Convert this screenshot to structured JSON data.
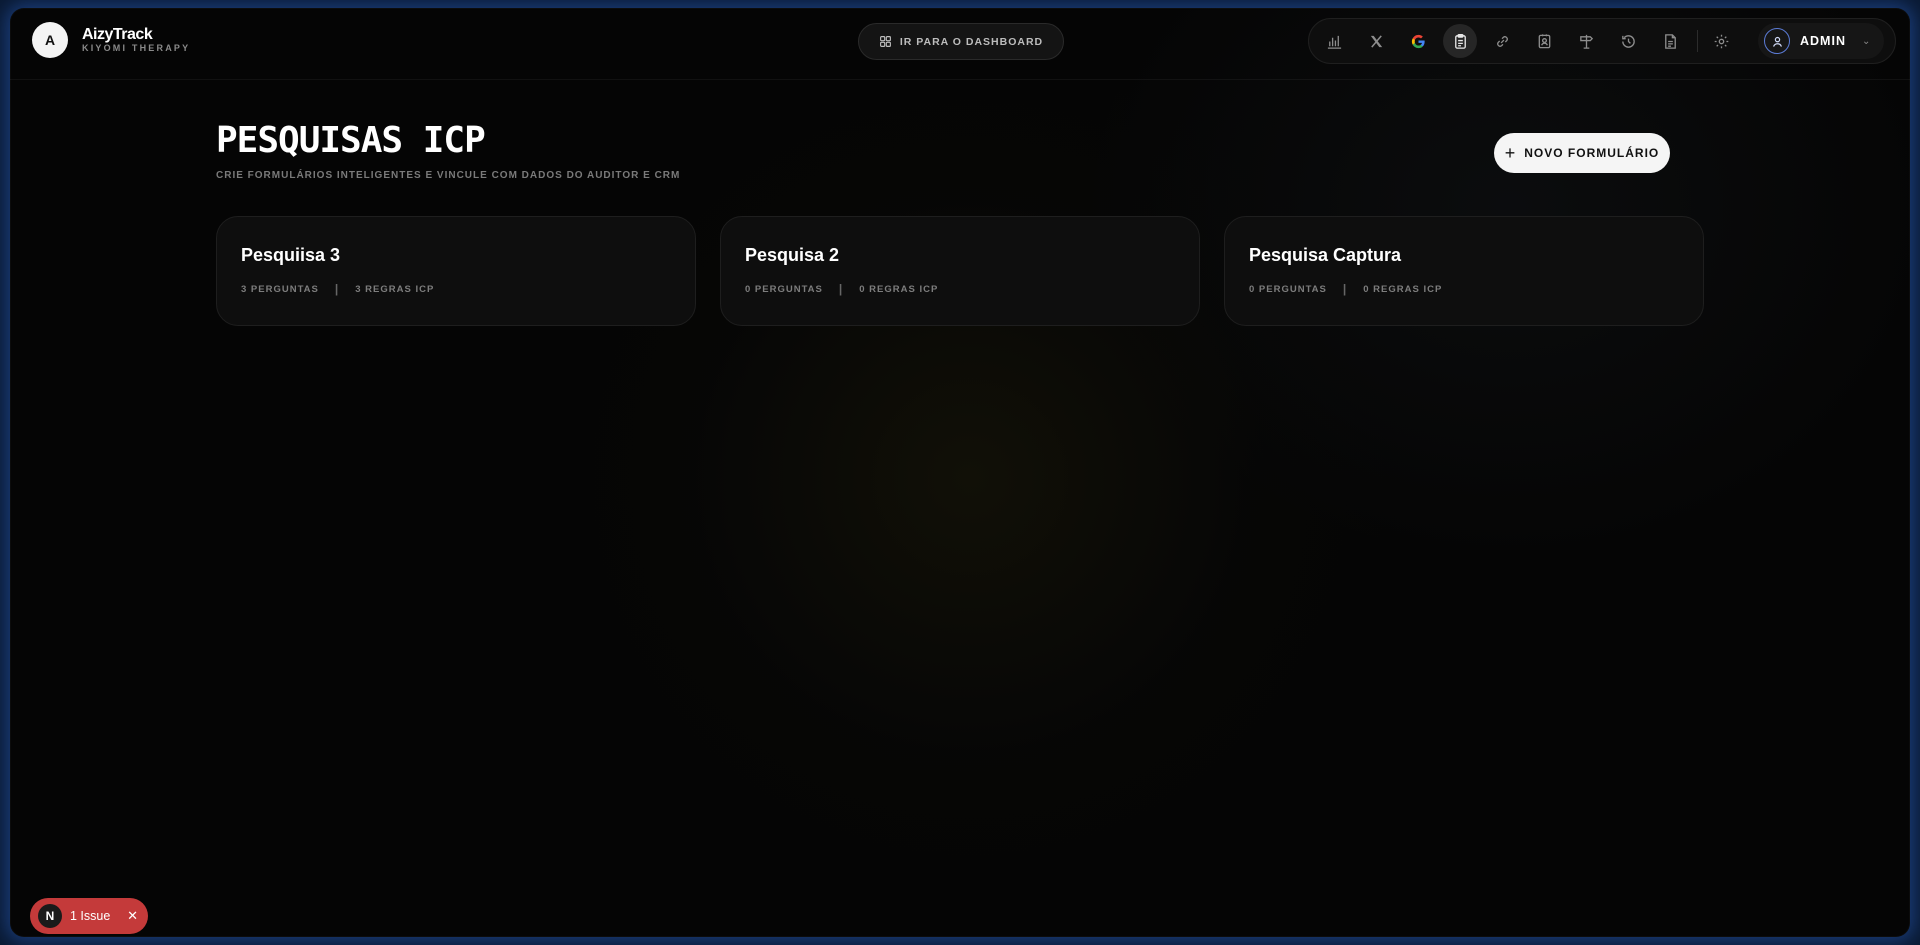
{
  "app": {
    "logo_letter": "A",
    "name": "AizyTrack",
    "subtitle": "KIYOMI THERAPY"
  },
  "header": {
    "dashboard_label": "IR PARA O DASHBOARD",
    "toolbar_icons": [
      "chart-bar-icon",
      "x-logo-icon",
      "google-icon",
      "clipboard-icon",
      "link-icon",
      "contact-card-icon",
      "signpost-icon",
      "history-icon",
      "document-icon",
      "gear-icon"
    ],
    "active_icon": "clipboard-icon",
    "user_label": "ADMIN"
  },
  "page": {
    "title": "PESQUISAS ICP",
    "subtitle": "CRIE FORMULÁRIOS INTELIGENTES E VINCULE COM DADOS DO AUDITOR E CRM",
    "new_button_label": "NOVO FORMULÁRIO"
  },
  "surveys": [
    {
      "title": "Pesquiisa 3",
      "questions": "3 PERGUNTAS",
      "rules": "3 REGRAS ICP"
    },
    {
      "title": "Pesquisa 2",
      "questions": "0 PERGUNTAS",
      "rules": "0 REGRAS ICP"
    },
    {
      "title": "Pesquisa Captura",
      "questions": "0 PERGUNTAS",
      "rules": "0 REGRAS ICP"
    }
  ],
  "dev_badge": {
    "letter": "N",
    "label": "1 Issue"
  },
  "colors": {
    "accent_border": "#285ab4",
    "issue_badge": "#c43a3a",
    "avatar_ring": "#5b7bd5"
  }
}
